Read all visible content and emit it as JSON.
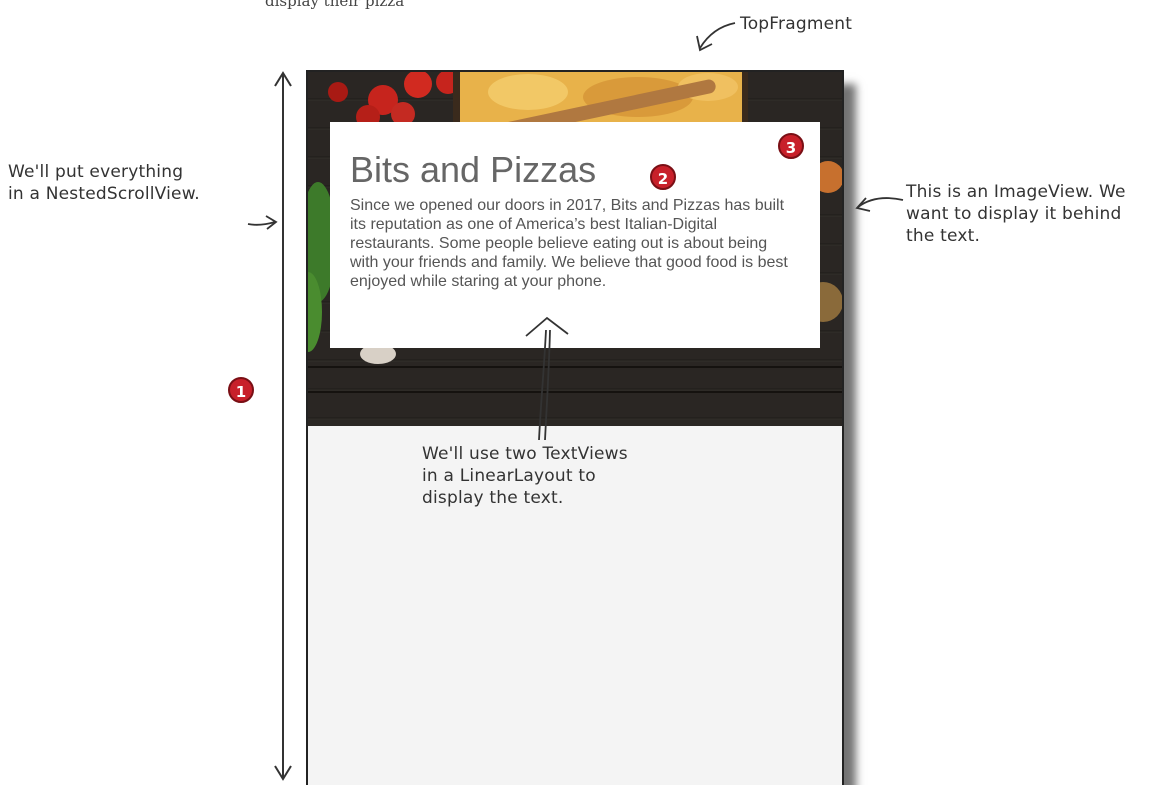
{
  "top_caption": "display their pizza",
  "labels": {
    "top_fragment": "TopFragment",
    "scroll_view": [
      "We'll put everything",
      "in a NestedScrollView."
    ],
    "image_view": [
      "This is an ImageView. We",
      "want to display it behind",
      "the text."
    ],
    "text_views": [
      "We'll use two TextViews",
      "in a LinearLayout to",
      "display the text."
    ]
  },
  "card": {
    "title": "Bits and Pizzas",
    "body": "Since we opened our doors in 2017, Bits and Pizzas has built its reputation as one of America’s best Italian-Digital restaurants. Some people believe eating out is about being with your friends and family. We believe that good food is best enjoyed while staring at your phone."
  },
  "badges": {
    "one": "1",
    "two": "2",
    "three": "3"
  },
  "colors": {
    "badge": "#c8202a",
    "frame": "#222222",
    "image_bg": "#2a2623"
  }
}
